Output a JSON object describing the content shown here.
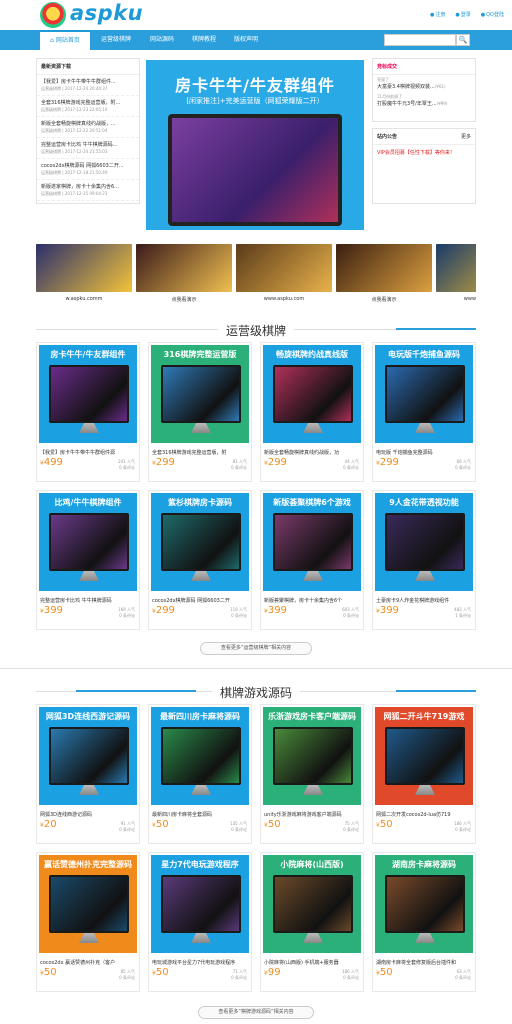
{
  "header": {
    "logo_text": "aspku",
    "links": [
      "注册",
      "登录",
      "QQ登陆"
    ]
  },
  "nav": {
    "items": [
      "网站首页",
      "运营级棋牌",
      "网站源码",
      "棋牌教程",
      "版权声明"
    ],
    "search_button": "🔍"
  },
  "news": {
    "title": "最新资源下载",
    "items": [
      {
        "title": "【我爱】房卡牛牛带牛牛群组件...",
        "meta": "运营级棋牌 | 2017-12-24 20:44:37"
      },
      {
        "title": "全套316棋牌游戏完整运营版，附...",
        "meta": "运营级棋牌 | 2017-12-23 22:05:10"
      },
      {
        "title": "新版全套畅旋棋牌真线约战版，...",
        "meta": "运营级棋牌 | 2017-12-22 20:51:04"
      },
      {
        "title": "完整运营房卡比鸡 牛牛棋牌源码...",
        "meta": "运营级棋牌 | 2017-12-20 21:55:03"
      },
      {
        "title": "cocos2dx棋牌源码 网狐6603二开...",
        "meta": "运营级棋牌 | 2017-12-18 21:50:49"
      },
      {
        "title": "新版遂家棋牌，房卡十余集内含6...",
        "meta": "运营级棋牌 | 2017-12-15 09:04:23"
      }
    ]
  },
  "banner": {
    "title": "房卡牛牛/牛友群组件",
    "subtitle": "[闲家推注]+完美运营版（网狐荣耀版二开）"
  },
  "bidding": {
    "title": "竞标成交",
    "items": [
      {
        "who": "亮晃了",
        "text": "大富豪3.4棋牌视频双装...",
        "price": "¥61"
      },
      {
        "who": "11月份前周了",
        "text": "打股魔牛牛元3号/年覃王...",
        "price": "¥99"
      }
    ]
  },
  "notice": {
    "title": "站内公告",
    "more": "更多",
    "item": "VIP会员招募【任性下载】等你来！"
  },
  "strip": {
    "items": [
      {
        "label": "w.aspku.comm",
        "color1": "#2a2f6b",
        "color2": "#f3c33a"
      },
      {
        "label": "点我看演示",
        "color1": "#3a1a1a",
        "color2": "#f0c050"
      },
      {
        "label": "www.aspku.com",
        "color1": "#5a3a1a",
        "color2": "#e9b24a"
      },
      {
        "label": "点我看演示",
        "color1": "#3a1f10",
        "color2": "#dca040"
      },
      {
        "label": "www.aspku.com",
        "color1": "#1a3a6b",
        "color2": "#f0c030"
      }
    ]
  },
  "section1": {
    "title": "运营级棋牌",
    "more": "查看更多“运营级棋牌”相关内容",
    "cards": [
      {
        "img_title": "房卡牛牛/牛友群组件",
        "name": "【我爱】房卡牛牛带牛牛群组件源",
        "price": "499",
        "views": "241 人气",
        "comments": "0 条评论",
        "bg": "#1ba1e2",
        "scr": "#6a2c8a"
      },
      {
        "img_title": "316棋牌完整运营版",
        "name": "全套316棋牌游戏完整运营版，附",
        "price": "299",
        "views": "81 人气",
        "comments": "0 条评论",
        "bg": "#2cb07a",
        "scr": "#2f7ab8"
      },
      {
        "img_title": "畅旋棋牌约战真线版",
        "name": "新版全套畅旋棋牌真线约战版，功",
        "price": "299",
        "views": "44 人气",
        "comments": "0 条评论",
        "bg": "#1ba1e2",
        "scr": "#b0305a"
      },
      {
        "img_title": "电玩版千炮捕鱼源码",
        "name": "电玩版 千炮捕鱼完整源码",
        "price": "299",
        "views": "66 人气",
        "comments": "0 条评论",
        "bg": "#1ba1e2",
        "scr": "#2a6ab0"
      },
      {
        "img_title": "比鸡/牛牛棋牌组件",
        "name": "完整运营房卡比鸡 牛牛棋牌源码",
        "price": "399",
        "views": "169 人气",
        "comments": "0 条评论",
        "bg": "#1ba1e2",
        "scr": "#6a3a8a"
      },
      {
        "img_title": "紫杉棋牌房卡源码",
        "name": "cocos2dx棋牌源码 网狐6603二开",
        "price": "299",
        "views": "119 人气",
        "comments": "0 条评论",
        "bg": "#1ba1e2",
        "scr": "#1f6a6b"
      },
      {
        "img_title": "新版荟聚棋牌6个游戏",
        "name": "新版荟聚棋牌，房卡十余集内含6个",
        "price": "399",
        "views": "603 人气",
        "comments": "0 条评论",
        "bg": "#1ba1e2",
        "scr": "#7a3a6a"
      },
      {
        "img_title": "9人金花带透视功能",
        "name": "土豪房卡9人炸金花棋牌游戏组件",
        "price": "399",
        "views": "483 人气",
        "comments": "1 条评论",
        "bg": "#1ba1e2",
        "scr": "#3a2a5a"
      }
    ]
  },
  "section2": {
    "title": "棋牌游戏源码",
    "more": "查看更多“棋牌游戏源码”相关内容",
    "cards": [
      {
        "img_title": "网狐3D连线西游记源码",
        "name": "网狐3D连线西游记源码",
        "price": "20",
        "views": "91 人气",
        "comments": "0 条评论",
        "bg": "#1ba1e2",
        "scr": "#2a7ab0"
      },
      {
        "img_title": "最新四川房卡麻将源码",
        "name": "最新四川房卡麻将全套源码",
        "price": "50",
        "views": "135 人气",
        "comments": "0 条评论",
        "bg": "#1ba1e2",
        "scr": "#2a8a4a"
      },
      {
        "img_title": "乐浙游戏房卡客户端源码",
        "name": "unity乐浙游戏麻将游戏客户端源码",
        "price": "50",
        "views": "75 人气",
        "comments": "0 条评论",
        "bg": "#2cb07a",
        "scr": "#4a8a3a"
      },
      {
        "img_title": "网狐二开斗牛719游戏",
        "name": "网狐二次开发cocos2d-lua仿719",
        "price": "50",
        "views": "186 人气",
        "comments": "0 条评论",
        "bg": "#e04a2a",
        "scr": "#1f5a8a"
      },
      {
        "img_title": "赢话赞德州扑克完整源码",
        "name": "cocos2dx 赢话赞德州扑克（客户",
        "price": "50",
        "views": "85 人气",
        "comments": "0 条评论",
        "bg": "#f08a1a",
        "scr": "#1a4a6a"
      },
      {
        "img_title": "星力7代电玩游戏程序",
        "name": "电玩城游戏平台星力7代电玩游戏程序",
        "price": "50",
        "views": "71 人气",
        "comments": "0 条评论",
        "bg": "#1ba1e2",
        "scr": "#5a3a7a"
      },
      {
        "img_title": "小院麻将(山西版)",
        "name": "小院麻将(山西版) 手机端+服务器",
        "price": "99",
        "views": "186 人气",
        "comments": "0 条评论",
        "bg": "#2cb07a",
        "scr": "#6a4a2a"
      },
      {
        "img_title": "湖南房卡麻将源码",
        "name": "湖南房卡麻将全套修复版后台插件和",
        "price": "50",
        "views": "63 人气",
        "comments": "0 条评论",
        "bg": "#2cb07a",
        "scr": "#7a4a2a"
      }
    ]
  }
}
